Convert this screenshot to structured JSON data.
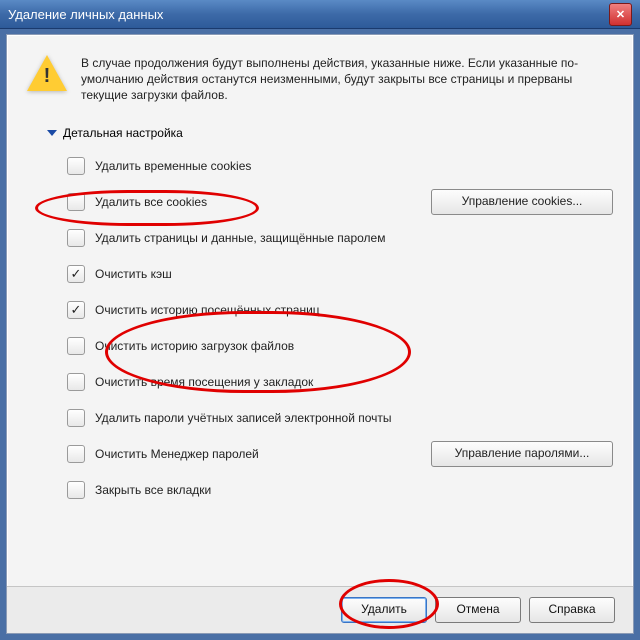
{
  "title": "Удаление личных данных",
  "close_glyph": "✕",
  "intro": "В случае продолжения будут выполнены действия, указанные ниже. Если указанные по-умолчанию действия останутся неизменными, будут закрыты все страницы и прерваны текущие загрузки файлов.",
  "toggle_label": "Детальная настройка",
  "options": [
    {
      "label": "Удалить временные cookies",
      "checked": false,
      "button": null
    },
    {
      "label": "Удалить все cookies",
      "checked": false,
      "button": "Управление cookies..."
    },
    {
      "label": "Удалить страницы и данные, защищённые паролем",
      "checked": false,
      "button": null
    },
    {
      "label": "Очистить кэш",
      "checked": true,
      "button": null
    },
    {
      "label": "Очистить историю посещённых страниц",
      "checked": true,
      "button": null
    },
    {
      "label": "Очистить историю загрузок файлов",
      "checked": false,
      "button": null
    },
    {
      "label": "Очистить время посещения у закладок",
      "checked": false,
      "button": null
    },
    {
      "label": "Удалить пароли учётных записей электронной почты",
      "checked": false,
      "button": null
    },
    {
      "label": "Очистить Менеджер паролей",
      "checked": false,
      "button": "Управление паролями..."
    },
    {
      "label": "Закрыть все вкладки",
      "checked": false,
      "button": null
    }
  ],
  "buttons": {
    "delete": "Удалить",
    "cancel": "Отмена",
    "help": "Справка"
  },
  "check_glyph": "✓"
}
